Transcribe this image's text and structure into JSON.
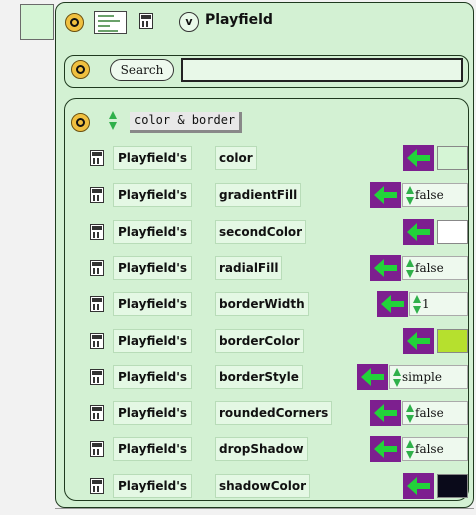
{
  "header": {
    "title": "Playfield",
    "v_label": "v"
  },
  "search": {
    "button_label": "Search",
    "value": ""
  },
  "category": {
    "label": "color & border"
  },
  "properties": [
    {
      "owner": "Playfield's",
      "name": "color",
      "value_type": "color",
      "value": "#d5f5d5"
    },
    {
      "owner": "Playfield's",
      "name": "gradientFill",
      "value_type": "text",
      "value": "false"
    },
    {
      "owner": "Playfield's",
      "name": "secondColor",
      "value_type": "color",
      "value": "#ffffff"
    },
    {
      "owner": "Playfield's",
      "name": "radialFill",
      "value_type": "text",
      "value": "false"
    },
    {
      "owner": "Playfield's",
      "name": "borderWidth",
      "value_type": "text",
      "value": "1"
    },
    {
      "owner": "Playfield's",
      "name": "borderColor",
      "value_type": "color",
      "value": "#b6e02e"
    },
    {
      "owner": "Playfield's",
      "name": "borderStyle",
      "value_type": "text",
      "value": "simple"
    },
    {
      "owner": "Playfield's",
      "name": "roundedCorners",
      "value_type": "text",
      "value": "false"
    },
    {
      "owner": "Playfield's",
      "name": "dropShadow",
      "value_type": "text",
      "value": "false"
    },
    {
      "owner": "Playfield's",
      "name": "shadowColor",
      "value_type": "color",
      "value": "#0a0a1a"
    }
  ],
  "colors": {
    "panel_bg": "#d3f1d3",
    "arrow_bg": "#7d1f8f",
    "arrow_fg": "#22d33a",
    "updown": "#2fb04a",
    "menu_button": "#f0c040"
  },
  "icons": {
    "menu": "circle-menu-icon",
    "tile": "tile-icon",
    "thumbnail": "thumbnail-icon",
    "assign": "left-arrow-icon",
    "updown": "up-down-arrows-icon"
  }
}
